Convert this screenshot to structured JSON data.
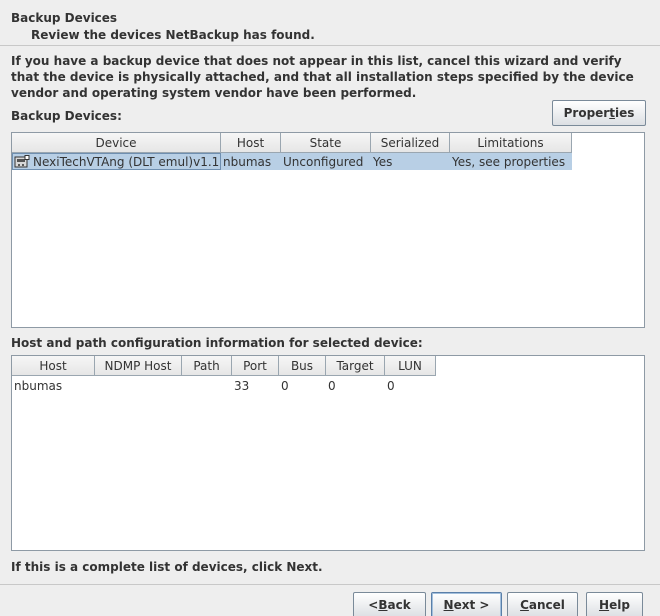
{
  "header": {
    "title": "Backup Devices",
    "subtitle": "Review the devices NetBackup has found."
  },
  "intro": "If you have a backup device that does not appear in this list, cancel this wizard and verify that the device is physically attached, and that all installation steps specified by the device vendor and operating system vendor have been performed.",
  "devices": {
    "label": "Backup Devices:",
    "properties_pre": "Proper",
    "properties_mn": "t",
    "properties_post": "ies",
    "columns": [
      "Device",
      "Host",
      "State",
      "Serialized",
      "Limitations"
    ],
    "rows": [
      {
        "device": "NexiTechVTAng (DLT emul)v1.1",
        "device_icon": "tape-drive-icon",
        "host": "nbumas",
        "state": "Unconfigured",
        "serialized": "Yes",
        "limitations": "Yes, see properties"
      }
    ]
  },
  "config": {
    "label": "Host and path configuration information for selected device:",
    "columns": [
      "Host",
      "NDMP Host",
      "Path",
      "Port",
      "Bus",
      "Target",
      "LUN"
    ],
    "rows": [
      {
        "host": "nbumas",
        "ndmp_host": "",
        "path": "",
        "port": "33",
        "bus": "0",
        "target": "0",
        "lun": "0"
      }
    ]
  },
  "footer_hint": "If this is a complete list of devices, click Next.",
  "buttons": {
    "back_pre": "< ",
    "back_mn": "B",
    "back_post": "ack",
    "next_mn": "N",
    "next_post": "ext >",
    "cancel_mn": "C",
    "cancel_post": "ancel",
    "help_mn": "H",
    "help_post": "elp"
  },
  "colors": {
    "background": "#eeeeee",
    "selection": "#b8cfe5",
    "table_border": "#8e9aa5"
  }
}
